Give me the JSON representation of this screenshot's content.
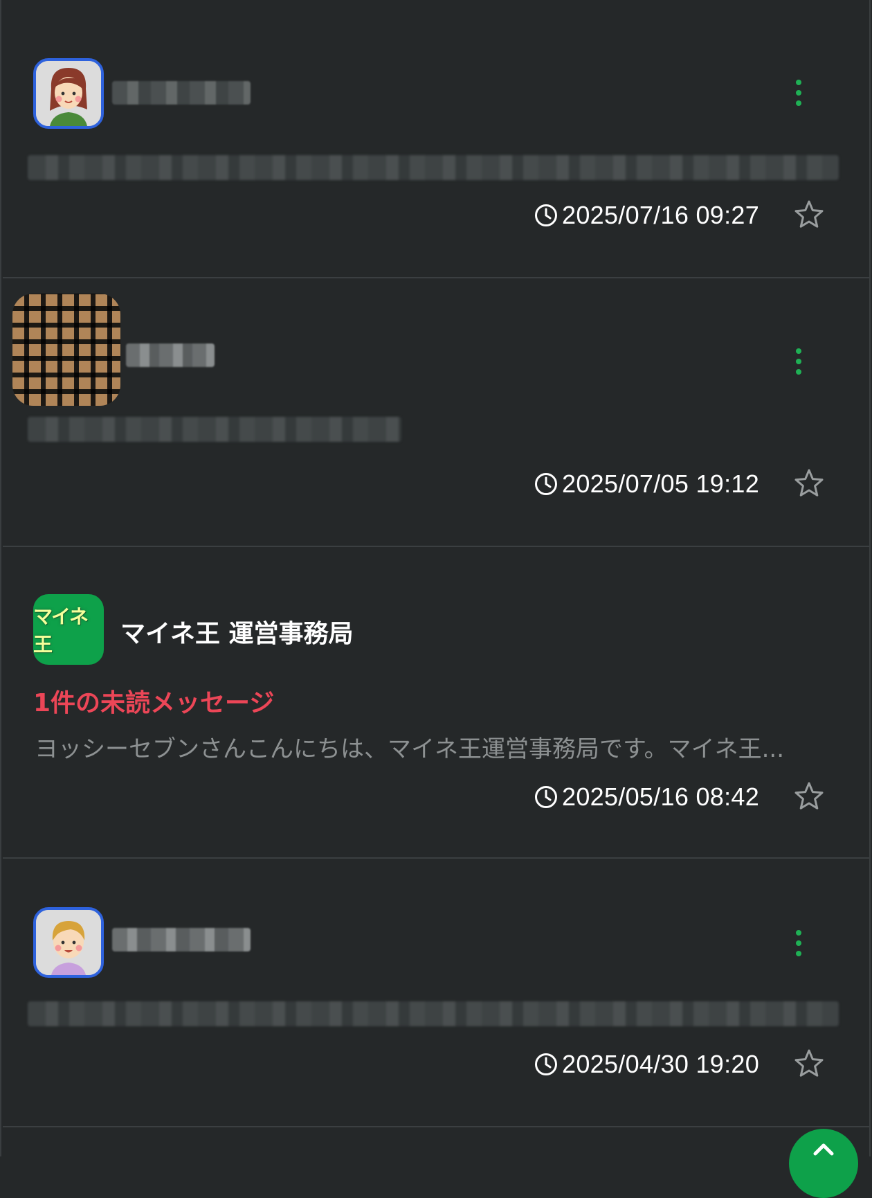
{
  "colors": {
    "background": "#252829",
    "divider": "#3b3f41",
    "accent_green": "#1fb155",
    "unread_red": "#ec4657",
    "avatar_border_blue": "#2e62dd",
    "brand_green": "#0ea14a"
  },
  "messages": [
    {
      "avatar": "woman-avatar-icon",
      "timestamp": "2025/07/16 09:27"
    },
    {
      "avatar": "pixelated-avatar-icon",
      "timestamp": "2025/07/05 19:12"
    },
    {
      "avatar": "maine-ou-logo-icon",
      "avatar_text": "マイネ王",
      "sender": "マイネ王 運営事務局",
      "unread": "1件の未読メッセージ",
      "preview": "ヨッシーセブンさんこんにちは、マイネ王運営事務局です。マイネ王...",
      "timestamp": "2025/05/16 08:42"
    },
    {
      "avatar": "boy-avatar-icon",
      "timestamp": "2025/04/30 19:20"
    }
  ],
  "icons": {
    "menu": "more-vertical-icon",
    "time": "clock-icon",
    "favorite": "star-outline-icon",
    "scroll_top": "chevron-up-icon"
  }
}
